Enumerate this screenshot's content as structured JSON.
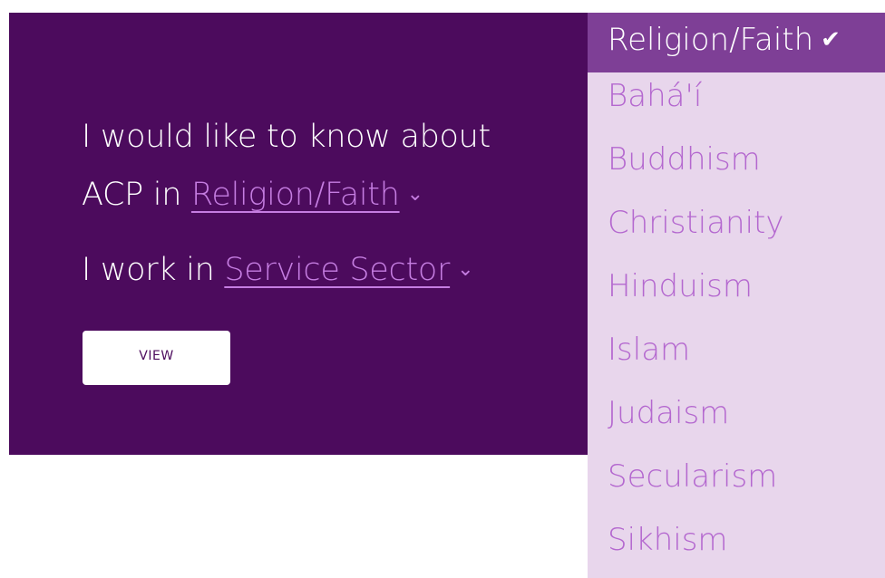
{
  "form": {
    "sentence1_part1": "I would like to know about",
    "sentence1_part2": "ACP in ",
    "religion_value": "Religion/Faith",
    "sentence2_prefix": "I work in ",
    "sector_value": "Service Sector",
    "view_button": "VIEW"
  },
  "dropdown": {
    "selected": "Religion/Faith",
    "options": [
      "Bahá'í",
      "Buddhism",
      "Christianity",
      "Hinduism",
      "Islam",
      "Judaism",
      "Secularism",
      "Sikhism"
    ]
  },
  "icons": {
    "chevron": "chevron-down-icon",
    "check": "check-icon"
  },
  "colors": {
    "panel_bg": "#4c0b5d",
    "link": "#c57de1",
    "dropdown_bg": "#e8d6ec",
    "dropdown_selected_bg": "#7e3f96",
    "dropdown_item_text": "#b468cf"
  }
}
